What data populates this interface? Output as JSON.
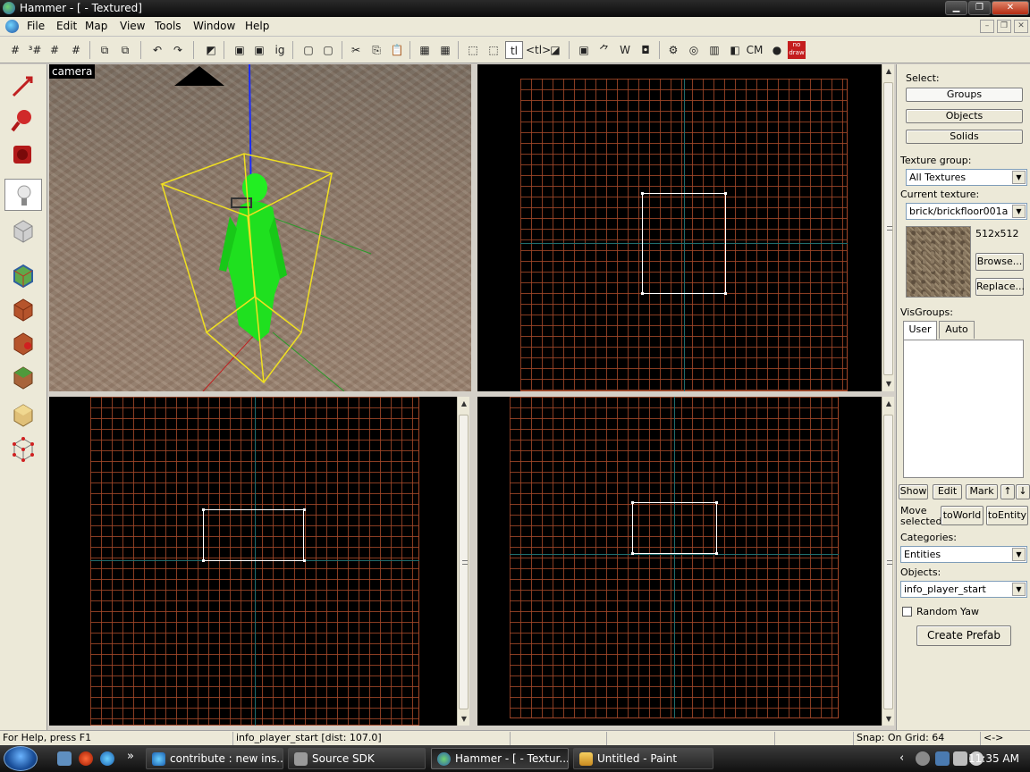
{
  "window": {
    "title": "Hammer - [ - Textured]",
    "minimize": "0",
    "maximize": "1",
    "close": "✕"
  },
  "menu": [
    "File",
    "Edit",
    "Map",
    "View",
    "Tools",
    "Window",
    "Help"
  ],
  "mdi_controls": [
    "–",
    "❐",
    "✕"
  ],
  "toolbar": {
    "text_buttons": {
      "ig": "ig",
      "tl": "tl",
      "tl_arrows": "<tl>",
      "cm": "CM",
      "nodraw": "no draw"
    }
  },
  "viewports": {
    "camera_label": "camera"
  },
  "right_panel": {
    "select_label": "Select:",
    "select_buttons": [
      "Groups",
      "Objects",
      "Solids"
    ],
    "texture_group_label": "Texture group:",
    "texture_group_value": "All Textures",
    "current_texture_label": "Current texture:",
    "current_texture_value": "brick/brickfloor001a",
    "texture_size": "512x512",
    "browse_button": "Browse...",
    "replace_button": "Replace...",
    "visgroups_label": "VisGroups:",
    "visgroup_tabs": [
      "User",
      "Auto"
    ],
    "vis_buttons": [
      "Show",
      "Edit",
      "Mark",
      "↑",
      "↓"
    ],
    "move_selected_label_1": "Move",
    "move_selected_label_2": "selected:",
    "to_world_button": "toWorld",
    "to_entity_button": "toEntity",
    "categories_label": "Categories:",
    "categories_value": "Entities",
    "objects_label": "Objects:",
    "objects_value": "info_player_start",
    "random_yaw_label": "Random Yaw",
    "create_prefab_button": "Create Prefab"
  },
  "statusbar": {
    "help": "For Help, press F1",
    "selection": "info_player_start  [dist: 107.0]",
    "snap": "Snap: On Grid: 64",
    "arrows": "<->"
  },
  "taskbar": {
    "tasks": [
      "contribute : new ins...",
      "Source SDK",
      "Hammer - [ - Textur...",
      "Untitled - Paint"
    ],
    "chevron": "»",
    "tray_chevron": "‹",
    "clock": "11:35 AM"
  },
  "colors": {
    "grid_line": "#a04628",
    "axis_line": "#1f6d6d",
    "selection": "#ffffff",
    "player_model": "#22ee22",
    "bbox": "#f0e020"
  }
}
